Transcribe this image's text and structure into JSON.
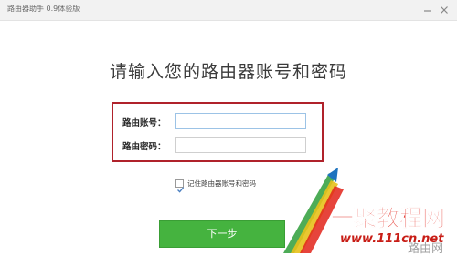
{
  "window": {
    "title": "路由器助手 0.9体验版"
  },
  "main": {
    "heading": "请输入您的路由器账号和密码"
  },
  "form": {
    "account_label": "路由账号：",
    "account_value": "",
    "password_label": "路由密码：",
    "password_value": ""
  },
  "remember": {
    "label": "记住路由器账号和密码",
    "checked": true
  },
  "next_button": {
    "label": "下一步"
  },
  "watermark": {
    "brand_text": "一聚教程网",
    "domain_text": "www.111cn.net",
    "corner_text": "路由网"
  },
  "colors": {
    "accent_green": "#45b33f",
    "highlight_red": "#b0222b",
    "watermark_red": "#e2231a"
  },
  "icons": {
    "minimize": "minimize-icon",
    "close": "close-icon",
    "check": "check-icon"
  }
}
